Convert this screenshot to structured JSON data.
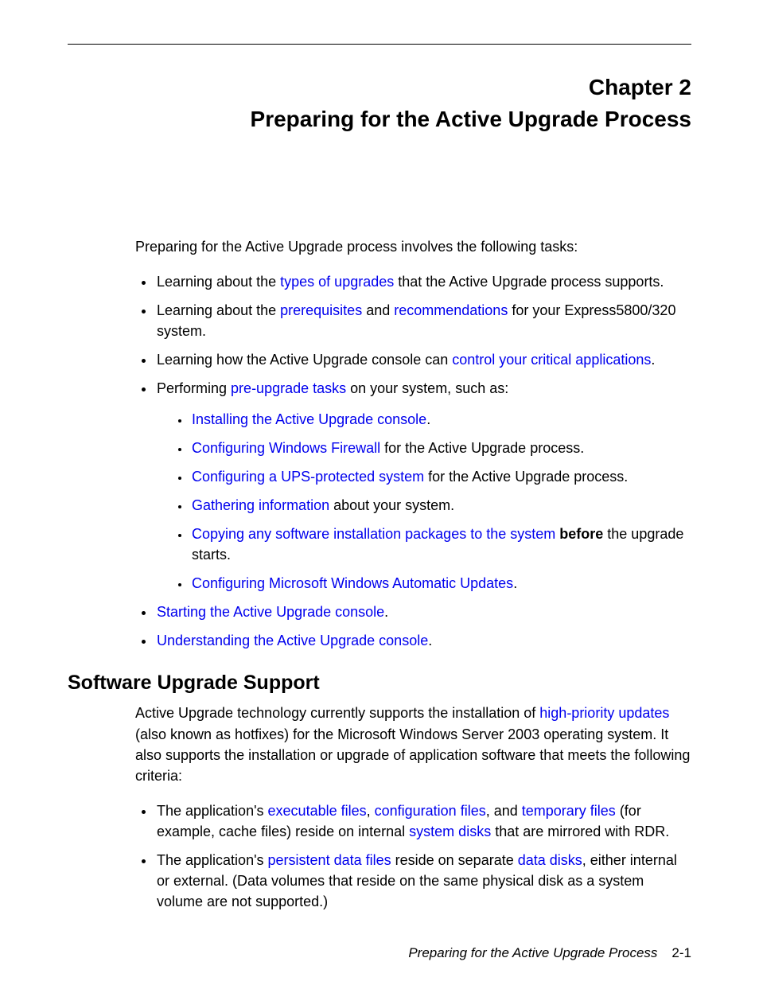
{
  "chapter": {
    "label": "Chapter 2",
    "title": "Preparing for the Active Upgrade Process"
  },
  "intro": "Preparing for the Active Upgrade process involves the following tasks:",
  "bullets": {
    "b1_pre": "Learning about the ",
    "b1_link": "types of upgrades",
    "b1_post": " that the Active Upgrade process supports.",
    "b2_pre": "Learning about the ",
    "b2_link1": "prerequisites",
    "b2_mid": " and ",
    "b2_link2": "recommendations",
    "b2_post1": " for your Express5800/320",
    "b2_post2": " system.",
    "b3_pre": "Learning how the Active Upgrade console can ",
    "b3_link": "control your critical applications",
    "b3_post": ".",
    "b4_pre": "Performing ",
    "b4_link": "pre-upgrade tasks",
    "b4_post": " on your system, such as:",
    "sub1_link": "Installing the Active Upgrade console",
    "sub1_post": ".",
    "sub2_link": "Configuring Windows Firewall",
    "sub2_post": " for the Active Upgrade process.",
    "sub3_link": "Configuring a UPS-protected system",
    "sub3_post": " for the Active Upgrade process.",
    "sub4_link": "Gathering information",
    "sub4_post": " about your system.",
    "sub5_link": "Copying any software installation packages to the system",
    "sub5_bold": "before",
    "sub5_post": " the upgrade starts.",
    "sub6_link": "Configuring Microsoft Windows Automatic Updates",
    "sub6_post": ".",
    "b5_link": "Starting the Active Upgrade console",
    "b5_post": ".",
    "b6_link": "Understanding the Active Upgrade console",
    "b6_post": "."
  },
  "section": {
    "heading": "Software Upgrade Support",
    "intro_pre": "Active Upgrade technology currently supports the installation of ",
    "intro_link": "high-priority updates",
    "intro_post": " (also known as hotfixes) for the Microsoft Windows Server 2003 operating system. It also supports the installation or upgrade of application software that meets the following criteria:",
    "sb1_pre": "The application's ",
    "sb1_link1": "executable files",
    "sb1_mid1": ", ",
    "sb1_link2": "configuration files",
    "sb1_mid2": ", and ",
    "sb1_link3": "temporary files",
    "sb1_mid3": " (for example, cache files) reside on internal ",
    "sb1_link4": "system disks",
    "sb1_post": " that are mirrored with RDR.",
    "sb2_pre": "The application's ",
    "sb2_link1": "persistent data files",
    "sb2_mid": " reside on separate ",
    "sb2_link2": "data disks",
    "sb2_post": ", either internal or external. (Data volumes that reside on the same physical disk as a system volume are not supported.)"
  },
  "footer": {
    "title": "Preparing for the Active Upgrade Process",
    "page": "2-1"
  }
}
